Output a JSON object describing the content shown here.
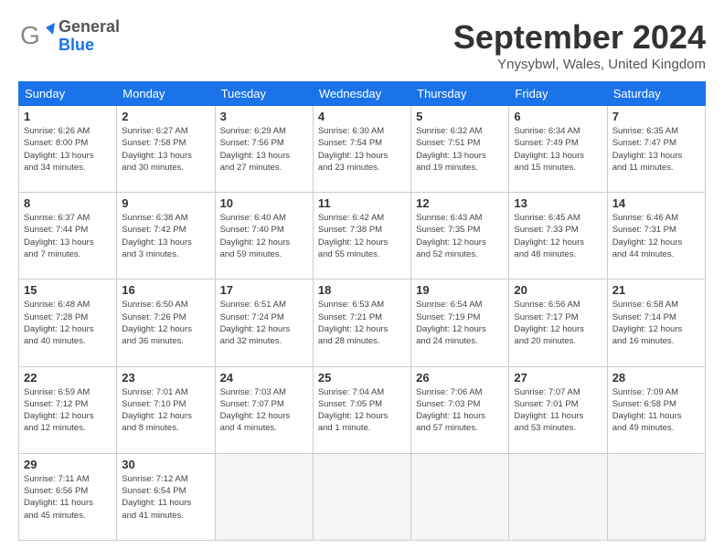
{
  "header": {
    "logo_general": "General",
    "logo_blue": "Blue",
    "month_title": "September 2024",
    "location": "Ynysybwl, Wales, United Kingdom"
  },
  "weekdays": [
    "Sunday",
    "Monday",
    "Tuesday",
    "Wednesday",
    "Thursday",
    "Friday",
    "Saturday"
  ],
  "weeks": [
    [
      {
        "day": "1",
        "info": "Sunrise: 6:26 AM\nSunset: 8:00 PM\nDaylight: 13 hours\nand 34 minutes."
      },
      {
        "day": "2",
        "info": "Sunrise: 6:27 AM\nSunset: 7:58 PM\nDaylight: 13 hours\nand 30 minutes."
      },
      {
        "day": "3",
        "info": "Sunrise: 6:29 AM\nSunset: 7:56 PM\nDaylight: 13 hours\nand 27 minutes."
      },
      {
        "day": "4",
        "info": "Sunrise: 6:30 AM\nSunset: 7:54 PM\nDaylight: 13 hours\nand 23 minutes."
      },
      {
        "day": "5",
        "info": "Sunrise: 6:32 AM\nSunset: 7:51 PM\nDaylight: 13 hours\nand 19 minutes."
      },
      {
        "day": "6",
        "info": "Sunrise: 6:34 AM\nSunset: 7:49 PM\nDaylight: 13 hours\nand 15 minutes."
      },
      {
        "day": "7",
        "info": "Sunrise: 6:35 AM\nSunset: 7:47 PM\nDaylight: 13 hours\nand 11 minutes."
      }
    ],
    [
      {
        "day": "8",
        "info": "Sunrise: 6:37 AM\nSunset: 7:44 PM\nDaylight: 13 hours\nand 7 minutes."
      },
      {
        "day": "9",
        "info": "Sunrise: 6:38 AM\nSunset: 7:42 PM\nDaylight: 13 hours\nand 3 minutes."
      },
      {
        "day": "10",
        "info": "Sunrise: 6:40 AM\nSunset: 7:40 PM\nDaylight: 12 hours\nand 59 minutes."
      },
      {
        "day": "11",
        "info": "Sunrise: 6:42 AM\nSunset: 7:38 PM\nDaylight: 12 hours\nand 55 minutes."
      },
      {
        "day": "12",
        "info": "Sunrise: 6:43 AM\nSunset: 7:35 PM\nDaylight: 12 hours\nand 52 minutes."
      },
      {
        "day": "13",
        "info": "Sunrise: 6:45 AM\nSunset: 7:33 PM\nDaylight: 12 hours\nand 48 minutes."
      },
      {
        "day": "14",
        "info": "Sunrise: 6:46 AM\nSunset: 7:31 PM\nDaylight: 12 hours\nand 44 minutes."
      }
    ],
    [
      {
        "day": "15",
        "info": "Sunrise: 6:48 AM\nSunset: 7:28 PM\nDaylight: 12 hours\nand 40 minutes."
      },
      {
        "day": "16",
        "info": "Sunrise: 6:50 AM\nSunset: 7:26 PM\nDaylight: 12 hours\nand 36 minutes."
      },
      {
        "day": "17",
        "info": "Sunrise: 6:51 AM\nSunset: 7:24 PM\nDaylight: 12 hours\nand 32 minutes."
      },
      {
        "day": "18",
        "info": "Sunrise: 6:53 AM\nSunset: 7:21 PM\nDaylight: 12 hours\nand 28 minutes."
      },
      {
        "day": "19",
        "info": "Sunrise: 6:54 AM\nSunset: 7:19 PM\nDaylight: 12 hours\nand 24 minutes."
      },
      {
        "day": "20",
        "info": "Sunrise: 6:56 AM\nSunset: 7:17 PM\nDaylight: 12 hours\nand 20 minutes."
      },
      {
        "day": "21",
        "info": "Sunrise: 6:58 AM\nSunset: 7:14 PM\nDaylight: 12 hours\nand 16 minutes."
      }
    ],
    [
      {
        "day": "22",
        "info": "Sunrise: 6:59 AM\nSunset: 7:12 PM\nDaylight: 12 hours\nand 12 minutes."
      },
      {
        "day": "23",
        "info": "Sunrise: 7:01 AM\nSunset: 7:10 PM\nDaylight: 12 hours\nand 8 minutes."
      },
      {
        "day": "24",
        "info": "Sunrise: 7:03 AM\nSunset: 7:07 PM\nDaylight: 12 hours\nand 4 minutes."
      },
      {
        "day": "25",
        "info": "Sunrise: 7:04 AM\nSunset: 7:05 PM\nDaylight: 12 hours\nand 1 minute."
      },
      {
        "day": "26",
        "info": "Sunrise: 7:06 AM\nSunset: 7:03 PM\nDaylight: 11 hours\nand 57 minutes."
      },
      {
        "day": "27",
        "info": "Sunrise: 7:07 AM\nSunset: 7:01 PM\nDaylight: 11 hours\nand 53 minutes."
      },
      {
        "day": "28",
        "info": "Sunrise: 7:09 AM\nSunset: 6:58 PM\nDaylight: 11 hours\nand 49 minutes."
      }
    ],
    [
      {
        "day": "29",
        "info": "Sunrise: 7:11 AM\nSunset: 6:56 PM\nDaylight: 11 hours\nand 45 minutes."
      },
      {
        "day": "30",
        "info": "Sunrise: 7:12 AM\nSunset: 6:54 PM\nDaylight: 11 hours\nand 41 minutes."
      },
      {
        "day": "",
        "info": ""
      },
      {
        "day": "",
        "info": ""
      },
      {
        "day": "",
        "info": ""
      },
      {
        "day": "",
        "info": ""
      },
      {
        "day": "",
        "info": ""
      }
    ]
  ]
}
